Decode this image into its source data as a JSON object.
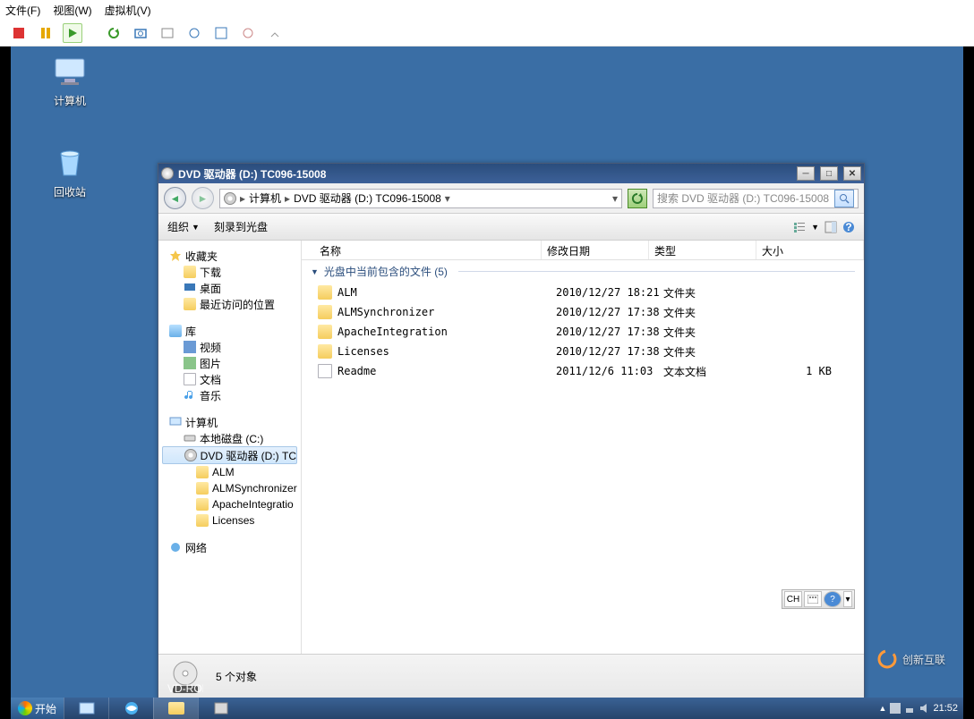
{
  "vm_menu": {
    "file": "文件(F)",
    "view": "视图(W)",
    "machine": "虚拟机(V)"
  },
  "desktop": {
    "icons": [
      {
        "label": "计算机"
      },
      {
        "label": "回收站"
      }
    ]
  },
  "window": {
    "title": "DVD 驱动器 (D:) TC096-15008",
    "breadcrumb": {
      "p0": "计算机",
      "p1": "DVD 驱动器 (D:) TC096-15008"
    },
    "search_placeholder": "搜索 DVD 驱动器 (D:) TC096-15008",
    "cmdbar": {
      "organize": "组织",
      "burn": "刻录到光盘"
    },
    "columns": {
      "name": "名称",
      "date": "修改日期",
      "type": "类型",
      "size": "大小"
    },
    "group_header": "光盘中当前包含的文件 (5)",
    "files": [
      {
        "icon": "folder",
        "name": "ALM",
        "date": "2010/12/27 18:21",
        "type": "文件夹",
        "size": ""
      },
      {
        "icon": "folder",
        "name": "ALMSynchronizer",
        "date": "2010/12/27 17:38",
        "type": "文件夹",
        "size": ""
      },
      {
        "icon": "folder",
        "name": "ApacheIntegration",
        "date": "2010/12/27 17:38",
        "type": "文件夹",
        "size": ""
      },
      {
        "icon": "folder",
        "name": "Licenses",
        "date": "2010/12/27 17:38",
        "type": "文件夹",
        "size": ""
      },
      {
        "icon": "file",
        "name": "Readme",
        "date": "2011/12/6 11:03",
        "type": "文本文档",
        "size": "1 KB"
      }
    ],
    "status": "5 个对象",
    "ime": {
      "langcode": "CH"
    }
  },
  "tree": {
    "favorites": {
      "label": "收藏夹",
      "downloads": "下载",
      "desktop": "桌面",
      "recent": "最近访问的位置"
    },
    "libraries": {
      "label": "库",
      "videos": "视频",
      "pictures": "图片",
      "documents": "文档",
      "music": "音乐"
    },
    "computer": {
      "label": "计算机",
      "local": "本地磁盘 (C:)",
      "dvd": "DVD 驱动器 (D:) TC",
      "sub": [
        "ALM",
        "ALMSynchronizer",
        "ApacheIntegratio",
        "Licenses"
      ]
    },
    "network": {
      "label": "网络"
    }
  },
  "taskbar": {
    "start": "开始",
    "time": "21:52"
  },
  "watermark": "创新互联"
}
